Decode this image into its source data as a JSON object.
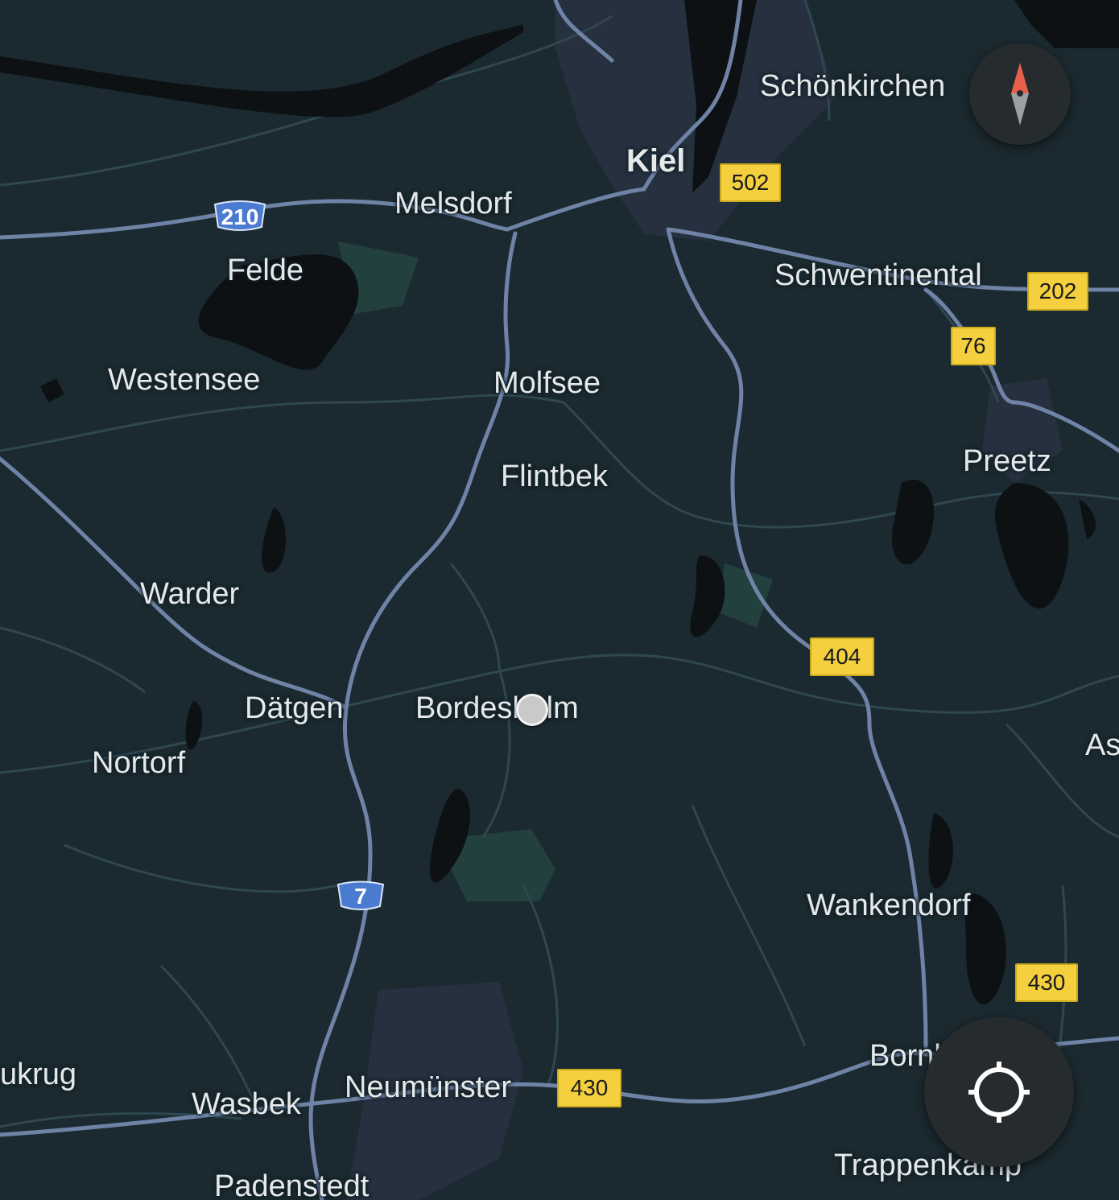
{
  "map": {
    "colors": {
      "land": "#1b2a30",
      "road_major": "#6f83a6",
      "road_minor": "#2f4750",
      "water": "#0d1114",
      "urban": "#26303f",
      "park": "#22403d",
      "label": "#e6e9ea"
    },
    "places": [
      {
        "name": "Schönkirchen",
        "type": "town"
      },
      {
        "name": "Kiel",
        "type": "city"
      },
      {
        "name": "Melsdorf",
        "type": "town"
      },
      {
        "name": "Felde",
        "type": "town"
      },
      {
        "name": "Schwentinental",
        "type": "town"
      },
      {
        "name": "Westensee",
        "type": "town"
      },
      {
        "name": "Molfsee",
        "type": "town"
      },
      {
        "name": "Flintbek",
        "type": "town"
      },
      {
        "name": "Preetz",
        "type": "town"
      },
      {
        "name": "Warder",
        "type": "town"
      },
      {
        "name": "Dätgen",
        "type": "town"
      },
      {
        "name": "Bordesholm",
        "type": "town"
      },
      {
        "name": "Nortorf",
        "type": "town"
      },
      {
        "name": "As",
        "type": "town"
      },
      {
        "name": "Wankendorf",
        "type": "town"
      },
      {
        "name": "ukrug",
        "type": "town"
      },
      {
        "name": "Wasbek",
        "type": "town"
      },
      {
        "name": "Neumünster",
        "type": "town"
      },
      {
        "name": "Bornhöved",
        "type": "town"
      },
      {
        "name": "Trappenkamp",
        "type": "town"
      },
      {
        "name": "Padenstedt",
        "type": "town"
      }
    ],
    "route_shields": [
      {
        "label": "502",
        "kind": "federal"
      },
      {
        "label": "210",
        "kind": "motorway"
      },
      {
        "label": "202",
        "kind": "federal"
      },
      {
        "label": "76",
        "kind": "federal"
      },
      {
        "label": "404",
        "kind": "federal"
      },
      {
        "label": "7",
        "kind": "motorway"
      },
      {
        "label": "430",
        "kind": "federal"
      },
      {
        "label": "430",
        "kind": "federal"
      }
    ],
    "controls": {
      "compass_icon": "compass-icon",
      "my_location_icon": "my-location-icon"
    }
  }
}
